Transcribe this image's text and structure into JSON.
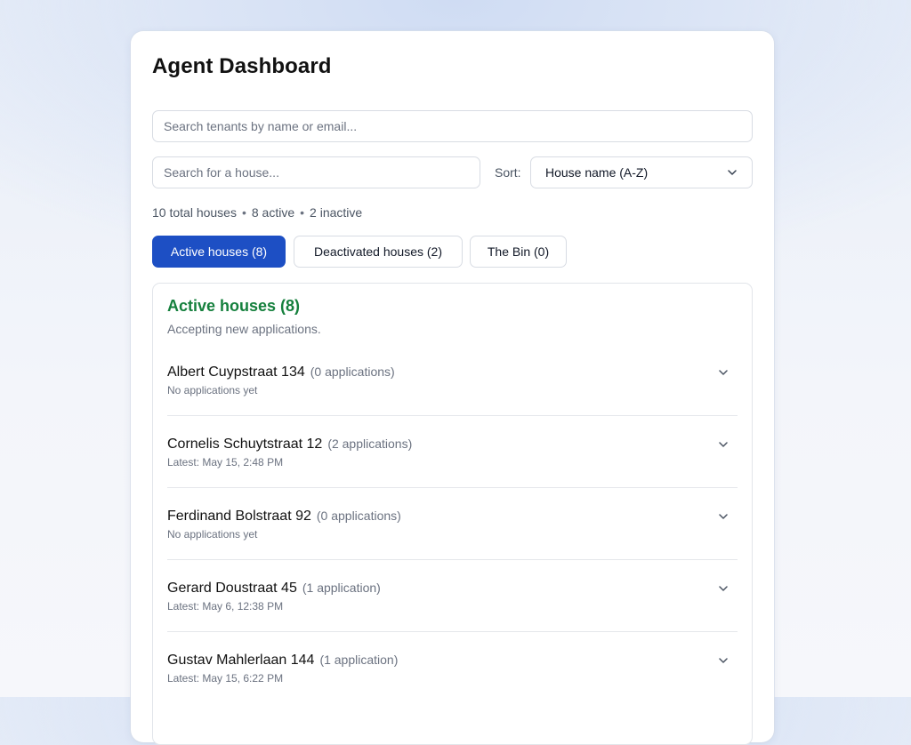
{
  "header": {
    "title": "Agent Dashboard"
  },
  "tenant_search": {
    "placeholder": "Search tenants by name or email..."
  },
  "house_search": {
    "placeholder": "Search for a house..."
  },
  "sort": {
    "label": "Sort:",
    "selected": "House name (A-Z)"
  },
  "stats": {
    "total": "10 total houses",
    "active": "8 active",
    "inactive": "2 inactive",
    "separator": "•"
  },
  "tabs": [
    {
      "label": "Active houses (8)",
      "selected": true
    },
    {
      "label": "Deactivated houses (2)",
      "selected": false
    },
    {
      "label": "The Bin (0)",
      "selected": false
    }
  ],
  "section": {
    "title": "Active houses (8)",
    "subtitle": "Accepting new applications."
  },
  "houses": [
    {
      "name": "Albert Cuypstraat 134",
      "count": "(0 applications)",
      "meta": "No applications yet"
    },
    {
      "name": "Cornelis Schuytstraat 12",
      "count": "(2 applications)",
      "meta": "Latest: May 15, 2:48 PM"
    },
    {
      "name": "Ferdinand Bolstraat 92",
      "count": "(0 applications)",
      "meta": "No applications yet"
    },
    {
      "name": "Gerard Doustraat 45",
      "count": "(1 application)",
      "meta": "Latest: May 6, 12:38 PM"
    },
    {
      "name": "Gustav Mahlerlaan 144",
      "count": "(1 application)",
      "meta": "Latest: May 15, 6:22 PM"
    }
  ],
  "colors": {
    "accent": "#1d4fc4",
    "section_title": "#15803d",
    "muted_text": "#6b7280"
  }
}
